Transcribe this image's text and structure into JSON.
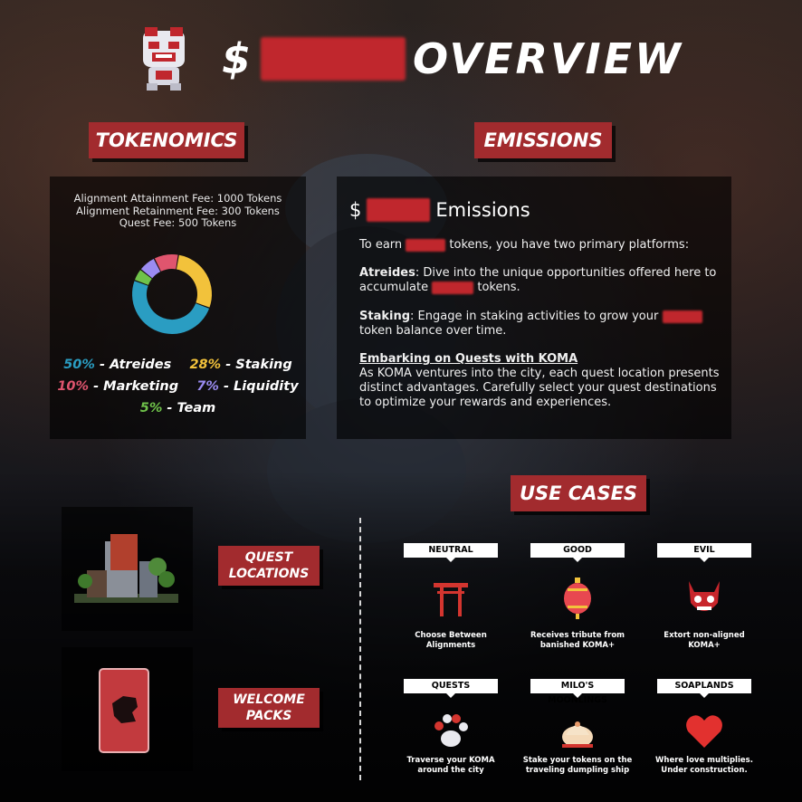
{
  "header": {
    "prefix": "$",
    "title": "OVERVIEW"
  },
  "labels": {
    "tokenomics": "TOKENOMICS",
    "emissions": "EMISSIONS",
    "use_cases": "USE CASES",
    "quest_locations_1": "QUEST",
    "quest_locations_2": "LOCATIONS",
    "welcome_packs_1": "WELCOME",
    "welcome_packs_2": "PACKS"
  },
  "tokenomics": {
    "fees": [
      "Alignment Attainment Fee: 1000 Tokens",
      "Alignment Retainment Fee: 300 Tokens",
      "Quest Fee: 500 Tokens"
    ],
    "distribution": [
      {
        "pct": "50%",
        "name": "- Atreides",
        "value": 50,
        "color": "#2a9dc2"
      },
      {
        "pct": "28%",
        "name": "- Staking",
        "value": 28,
        "color": "#f2c23b"
      },
      {
        "pct": "10%",
        "name": "- Marketing",
        "value": 10,
        "color": "#e0556e"
      },
      {
        "pct": "7%",
        "name": "- Liquidity",
        "value": 7,
        "color": "#9b8cf2"
      },
      {
        "pct": "5%",
        "name": "- Team",
        "value": 5,
        "color": "#6fc24a"
      }
    ]
  },
  "emissions": {
    "heading_prefix": "$",
    "heading_suffix": "Emissions",
    "intro_a": "To earn",
    "intro_b": "tokens, you have two primary platforms:",
    "atreides_label": "Atreides",
    "atreides_a": ": Dive into the unique opportunities offered here to accumulate",
    "atreides_b": "tokens.",
    "staking_label": "Staking",
    "staking_a": ": Engage in staking activities to grow your",
    "staking_b": "token balance over time.",
    "quests_heading": "Embarking on Quests with KOMA",
    "quests_body": "As KOMA ventures into the city, each quest location presents distinct advantages. Carefully select your quest destinations to optimize your rewards and experiences."
  },
  "use_cases": [
    {
      "tag": "NEUTRAL",
      "desc1": "Choose Between",
      "desc2": "Alignments",
      "icon": "torii-gate-icon"
    },
    {
      "tag": "GOOD",
      "desc1": "Receives tribute from",
      "desc2": "banished KOMA+",
      "icon": "lantern-icon"
    },
    {
      "tag": "EVIL",
      "desc1": "Extort non-aligned",
      "desc2": "KOMA+",
      "icon": "demon-mask-icon"
    },
    {
      "tag": "QUESTS",
      "desc1": "Traverse your KOMA",
      "desc2": "around the city",
      "icon": "paw-print-icon"
    },
    {
      "tag": "MILO'S MOONLINGS",
      "desc1": "Stake your tokens on the",
      "desc2": "traveling dumpling ship",
      "icon": "dumpling-icon"
    },
    {
      "tag": "SOAPLANDS",
      "desc1": "Where love multiplies.",
      "desc2": "Under construction.",
      "icon": "heart-icon"
    }
  ]
}
